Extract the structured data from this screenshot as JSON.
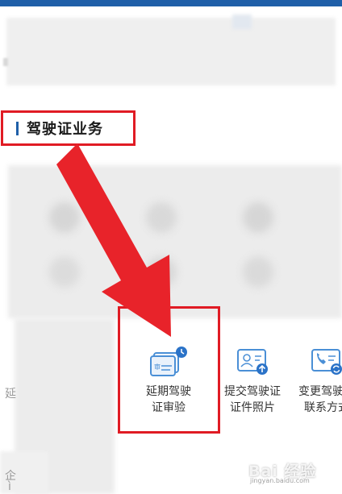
{
  "section": {
    "title": "驾驶证业务"
  },
  "fragments": {
    "left_cut_1": "延",
    "left_cut_2": "企",
    "left_cut_3": "ì"
  },
  "services": [
    {
      "label_line1": "延期驾驶",
      "label_line2": "证审验",
      "icon": "license-review-icon"
    },
    {
      "label_line1": "提交驾驶证",
      "label_line2": "证件照片",
      "icon": "license-photo-upload-icon"
    },
    {
      "label_line1": "变更驾驶证",
      "label_line2": "联系方式",
      "icon": "license-contact-change-icon"
    }
  ],
  "watermark": {
    "text": "Bai 经验",
    "sub": "jingyan.baidu.com"
  },
  "colors": {
    "accent": "#1f5fa8",
    "annotation_red": "#e01b24"
  }
}
